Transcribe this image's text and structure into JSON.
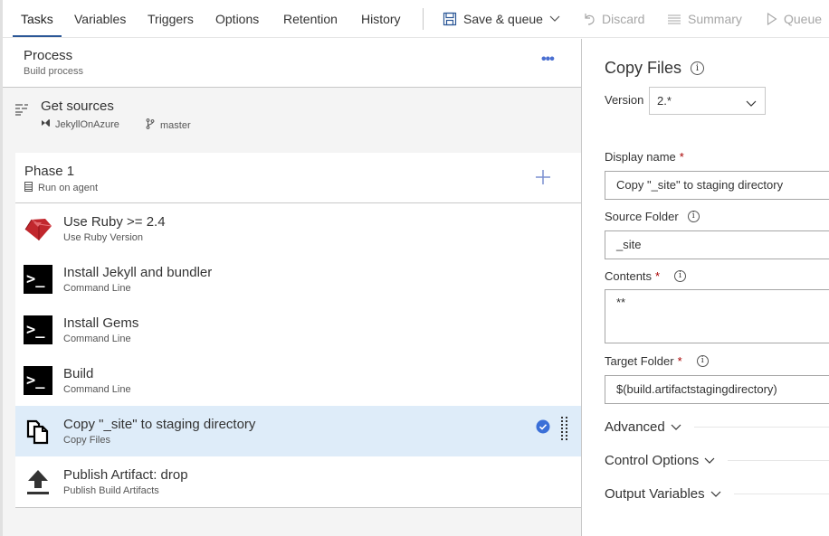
{
  "tabs": [
    {
      "label": "Tasks",
      "active": true
    },
    {
      "label": "Variables",
      "active": false
    },
    {
      "label": "Triggers",
      "active": false
    },
    {
      "label": "Options",
      "active": false
    },
    {
      "label": "Retention",
      "active": false
    },
    {
      "label": "History",
      "active": false
    }
  ],
  "toolbar": {
    "save_queue": {
      "label": "Save & queue",
      "icon": "save-icon",
      "enabled": true
    },
    "discard": {
      "label": "Discard",
      "icon": "undo-icon",
      "enabled": false
    },
    "summary": {
      "label": "Summary",
      "icon": "list-icon",
      "enabled": false
    },
    "queue": {
      "label": "Queue",
      "icon": "play-icon",
      "enabled": false
    }
  },
  "process": {
    "title": "Process",
    "subtitle": "Build process",
    "more_label": "•••"
  },
  "get_sources": {
    "title": "Get sources",
    "repo": "JekyllOnAzure",
    "branch": "master"
  },
  "phase": {
    "title": "Phase 1",
    "subtitle": "Run on agent"
  },
  "tasks": [
    {
      "name": "Use Ruby >= 2.4",
      "type": "Use Ruby Version",
      "icon": "ruby-icon",
      "selected": false
    },
    {
      "name": "Install Jekyll and bundler",
      "type": "Command Line",
      "icon": "terminal-icon",
      "selected": false
    },
    {
      "name": "Install Gems",
      "type": "Command Line",
      "icon": "terminal-icon",
      "selected": false
    },
    {
      "name": "Build",
      "type": "Command Line",
      "icon": "terminal-icon",
      "selected": false
    },
    {
      "name": "Copy \"_site\" to staging directory",
      "type": "Copy Files",
      "icon": "copy-icon",
      "selected": true
    },
    {
      "name": "Publish Artifact: drop",
      "type": "Publish Build Artifacts",
      "icon": "upload-icon",
      "selected": false
    }
  ],
  "terminal_glyph": ">_",
  "details": {
    "title": "Copy Files",
    "version_label": "Version",
    "version_value": "2.*",
    "display_name": {
      "label": "Display name",
      "required": "*",
      "value": "Copy \"_site\" to staging directory"
    },
    "source_folder": {
      "label": "Source Folder",
      "value": "_site"
    },
    "contents": {
      "label": "Contents",
      "required": "*",
      "value": "**"
    },
    "target_folder": {
      "label": "Target Folder",
      "required": "*",
      "value": "$(build.artifactstagingdirectory)"
    },
    "sections": [
      {
        "label": "Advanced"
      },
      {
        "label": "Control Options"
      },
      {
        "label": "Output Variables"
      }
    ],
    "info_glyph": "i"
  },
  "colors": {
    "accent": "#2b5797",
    "selected_row": "#deecf9",
    "link_blue": "#4a6fd1",
    "check_blue": "#3a6fd8",
    "required_red": "#a80000",
    "ruby_red": "#c1272d"
  }
}
